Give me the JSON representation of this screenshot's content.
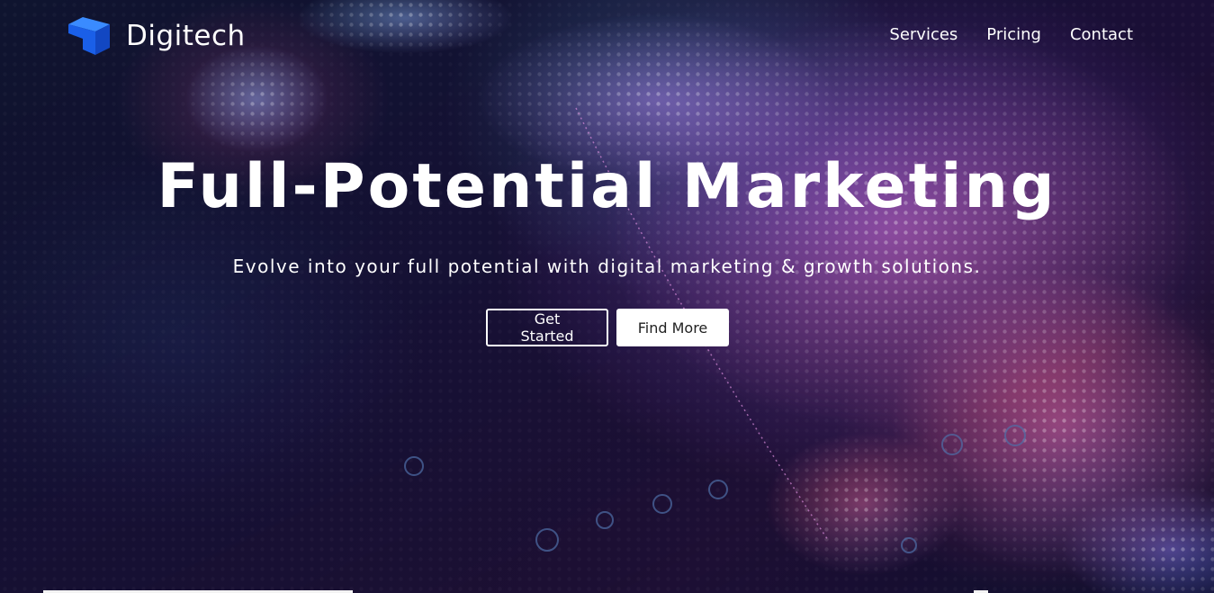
{
  "brand": {
    "name": "Digitech",
    "icon": "cube-logo-icon",
    "icon_color": "#1a73ff"
  },
  "nav": {
    "links": [
      {
        "label": "Services"
      },
      {
        "label": "Pricing"
      },
      {
        "label": "Contact"
      }
    ]
  },
  "hero": {
    "title": "Full-Potential Marketing",
    "subtitle": "Evolve into your full potential with digital marketing & growth solutions.",
    "buttons": {
      "primary_label": "Get Started",
      "secondary_label": "Find More"
    },
    "background": "dotted-world-map-image"
  },
  "colors": {
    "background": "#07061a",
    "text": "#ffffff",
    "button_solid_bg": "#ffffff",
    "button_solid_text": "#222222"
  }
}
